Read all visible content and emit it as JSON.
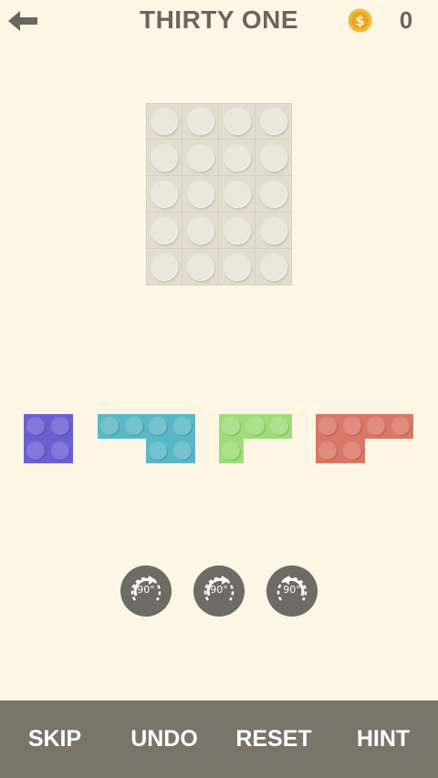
{
  "header": {
    "title": "THIRTY ONE",
    "coin_count": "0"
  },
  "board": {
    "rows": 5,
    "cols": 4
  },
  "pieces": [
    {
      "name": "purple-square-piece",
      "color": "#6b5fd3"
    },
    {
      "name": "teal-piece",
      "color": "#5ab8c6"
    },
    {
      "name": "green-piece",
      "color": "#9fdc78"
    },
    {
      "name": "red-piece",
      "color": "#da7767"
    }
  ],
  "rotate_buttons": [
    {
      "label": "90°",
      "direction": "clockwise"
    },
    {
      "label": "90°",
      "direction": "clockwise"
    },
    {
      "label": "90°",
      "direction": "counterclockwise"
    }
  ],
  "footer": {
    "skip": "SKIP",
    "undo": "UNDO",
    "reset": "RESET",
    "hint": "HINT"
  },
  "colors": {
    "background": "#fdf6e4",
    "footer_bar": "#7a746a",
    "text": "#6b655e",
    "coin": "#f3b93a"
  }
}
